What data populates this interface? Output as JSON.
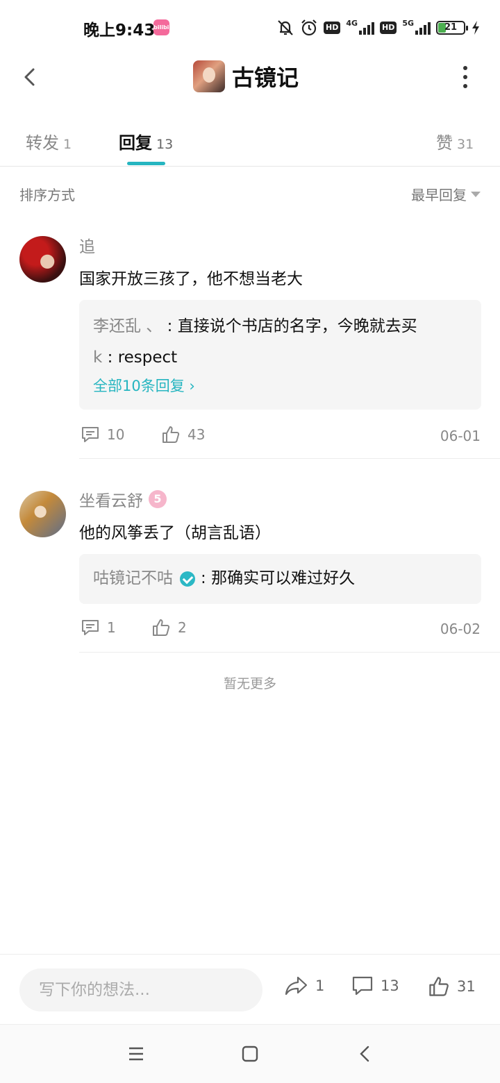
{
  "status_bar": {
    "time": "晚上9:43",
    "app_badge": "bilibili",
    "net1": "4G",
    "net2": "5G",
    "hd1": "HD",
    "hd2": "HD",
    "battery": "21"
  },
  "header": {
    "title": "古镜记"
  },
  "tabs": [
    {
      "label": "转发",
      "count": "1"
    },
    {
      "label": "回复",
      "count": "13"
    },
    {
      "label": "赞",
      "count": "31"
    }
  ],
  "sort": {
    "label": "排序方式",
    "value": "最早回复"
  },
  "comments": [
    {
      "user": "追",
      "text": "国家开放三孩了，他不想当老大",
      "replies": [
        {
          "user": "李还乱 、",
          "text": "直接说个书店的名字，今晚就去买"
        },
        {
          "user": "k",
          "text": "respect"
        }
      ],
      "more_replies": "全部10条回复 ›",
      "comment_count": "10",
      "like_count": "43",
      "date": "06-01"
    },
    {
      "user": "坐看云舒",
      "level": "5",
      "text": "他的风筝丢了（胡言乱语）",
      "replies": [
        {
          "user": "咕镜记不咕",
          "text": "那确实可以难过好久"
        }
      ],
      "comment_count": "1",
      "like_count": "2",
      "date": "06-02"
    }
  ],
  "end_text": "暂无更多",
  "bottom": {
    "input_placeholder": "写下你的想法...",
    "share_count": "1",
    "comment_count": "13",
    "like_count": "31"
  },
  "colors": {
    "accent": "#26b5c0",
    "muted": "#888888",
    "reply_bg": "#f5f5f5"
  }
}
